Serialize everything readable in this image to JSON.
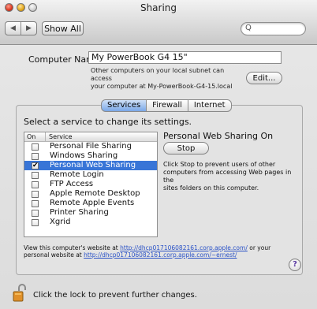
{
  "window": {
    "title": "Sharing"
  },
  "toolbar": {
    "back_glyph": "◀",
    "forward_glyph": "▶",
    "show_all_label": "Show All",
    "search_icon_glyph": "Q",
    "search_value": ""
  },
  "computer": {
    "name_label": "Computer Name:",
    "name_value": "My PowerBook G4 15\"",
    "note_line1": "Other computers on your local subnet can access",
    "note_line2": "your computer at My-PowerBook-G4-15.local",
    "edit_label": "Edit..."
  },
  "tabs": [
    {
      "label": "Services",
      "active": true
    },
    {
      "label": "Firewall",
      "active": false
    },
    {
      "label": "Internet",
      "active": false
    }
  ],
  "services": {
    "prompt": "Select a service to change its settings.",
    "header_on": "On",
    "header_service": "Service",
    "items": [
      {
        "label": "Personal File Sharing",
        "checked": false,
        "selected": false
      },
      {
        "label": "Windows Sharing",
        "checked": false,
        "selected": false
      },
      {
        "label": "Personal Web Sharing",
        "checked": true,
        "selected": true
      },
      {
        "label": "Remote Login",
        "checked": false,
        "selected": false
      },
      {
        "label": "FTP Access",
        "checked": false,
        "selected": false
      },
      {
        "label": "Apple Remote Desktop",
        "checked": false,
        "selected": false
      },
      {
        "label": "Remote Apple Events",
        "checked": false,
        "selected": false
      },
      {
        "label": "Printer Sharing",
        "checked": false,
        "selected": false
      },
      {
        "label": "Xgrid",
        "checked": false,
        "selected": false
      }
    ]
  },
  "status": {
    "title": "Personal Web Sharing On",
    "stop_label": "Stop",
    "desc_line1": "Click Stop to prevent users of other",
    "desc_line2": "computers from accessing Web pages in the",
    "desc_line3": "sites folders on this computer."
  },
  "website": {
    "prefix": "View this computer's website at ",
    "url1": "http://dhcp017106082161.corp.apple.com/",
    "middle": " or your",
    "line2_prefix": "personal website at ",
    "url2": "http://dhcp017106082161.corp.apple.com/~ernest/"
  },
  "help_glyph": "?",
  "footer": {
    "lock_text": "Click the lock to prevent further changes."
  },
  "colors": {
    "selection": "#3875d7",
    "link": "#2a52c7",
    "active_tab": "#7aa8e8"
  }
}
